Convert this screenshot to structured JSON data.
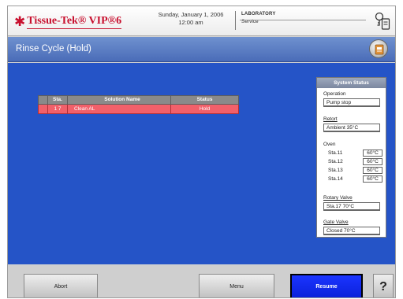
{
  "header": {
    "logo_text": "Tissue-Tek® VIP®6",
    "date": "Sunday, January 1, 2006",
    "time": "12:00 am",
    "location_line1": "LABORATORY",
    "location_line2": "Service",
    "icons": {
      "logo": "star-icon",
      "user": "access-key-icon"
    }
  },
  "titlebar": {
    "title": "Rinse Cycle (Hold)",
    "info_icon": "info-icon"
  },
  "table": {
    "columns": [
      "Sta.",
      "Solution Name",
      "Status"
    ],
    "rows": [
      {
        "station": "1 7",
        "solution": "Clean AL",
        "status": "Hold"
      }
    ]
  },
  "system_status": {
    "title": "System Status",
    "operation_label": "Operation",
    "operation_value": "Pump stop",
    "retort_label": "Retort",
    "retort_value": "Ambient 35°C",
    "oven_label": "Oven",
    "oven": [
      {
        "station": "Sta.11",
        "temp": "60°C"
      },
      {
        "station": "Sta.12",
        "temp": "60°C"
      },
      {
        "station": "Sta.13",
        "temp": "60°C"
      },
      {
        "station": "Sta.14",
        "temp": "60°C"
      }
    ],
    "rotary_label": "Rotary Valve",
    "rotary_value": "Sta.17 70°C",
    "gate_label": "Gate Valve",
    "gate_value": "Closed 70°C"
  },
  "bottombar": {
    "abort_label": "Abort",
    "menu_label": "Menu",
    "resume_label": "Resume",
    "help_label": "?"
  },
  "colors": {
    "brand": "#c8102e",
    "panel_blue": "#2554c7",
    "row_hold": "#f2606a",
    "resume": "#1b35ff"
  }
}
